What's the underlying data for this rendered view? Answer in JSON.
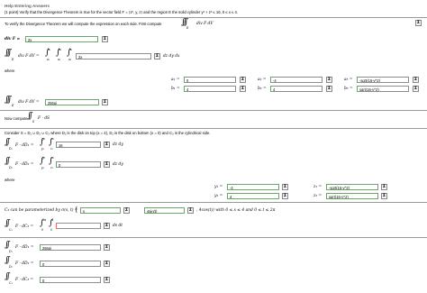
{
  "header": {
    "link": "Help Entering Answers",
    "problem": "(1 point) Verify that the Divergence Theorem is true for the vector field F = ⟨z², y, z⟩ and the region E the solid cylinder y² + z² ≤ 16, 0 ≤ x ≤ 4."
  },
  "intro": "To verify the Divergence Theorem we will compute the expression on each side. First compute",
  "intro_expr": "div F dV",
  "div_label": "div F =",
  "div_value": "2x",
  "triple_label": "div F dV =",
  "triple_value": "2x",
  "triple_tail": "dz dy dx",
  "where": "where",
  "limits1": [
    {
      "label": "a₁ =",
      "value": "0"
    },
    {
      "label": "b₁ =",
      "value": "4"
    },
    {
      "label": "a₂ =",
      "value": "-4"
    },
    {
      "label": "b₂ =",
      "value": "4"
    },
    {
      "label": "a₃ =",
      "value": "-sqrt(16-y^2)"
    },
    {
      "label": "b₃ =",
      "value": "sqrt(16-y^2)"
    }
  ],
  "triple_result_label": "div F dV =",
  "triple_result": "256pi",
  "now_compute": "Now compute",
  "now_expr": "F · dS",
  "consider": "Consider S = D₁ ∪ D₂ ∪ C₃ where D₁ is the disk on top (x = 4), D₂ is the disk on bottom (x = 0) and C₃ is the cylindrical side.",
  "d1_label": "F · dD₁ =",
  "d1_value": "16",
  "d2_label": "F · dD₂ =",
  "d2_value": "0",
  "d_tail": "dz dy",
  "where2": "where",
  "limits2": [
    {
      "label": "y₁ =",
      "value": "-4"
    },
    {
      "label": "y₂ =",
      "value": "4"
    },
    {
      "label": "z₁ =",
      "value": "-sqrt(16-y^2)"
    },
    {
      "label": "z₂ =",
      "value": "sqrt(16-y^2)"
    }
  ],
  "param_prefix": "C₃ can be parameterized by σ(s, t) =",
  "param_s": "s",
  "param_t": "4sin(t)",
  "param_suffix": ", 4cos(t)⟩ with 0 ≤ s ≤ 4 and 0 ≤ t ≤ 2π",
  "c3_label": "F · dC₃ =",
  "c3_value": "",
  "c3_tail": "ds dt",
  "final": [
    {
      "label": "F · dD₁ =",
      "value": "256pi"
    },
    {
      "label": "F · dD₂ =",
      "value": "0"
    },
    {
      "label": "F · dC₃ =",
      "value": "0"
    }
  ],
  "sigma_icon": "Σ"
}
